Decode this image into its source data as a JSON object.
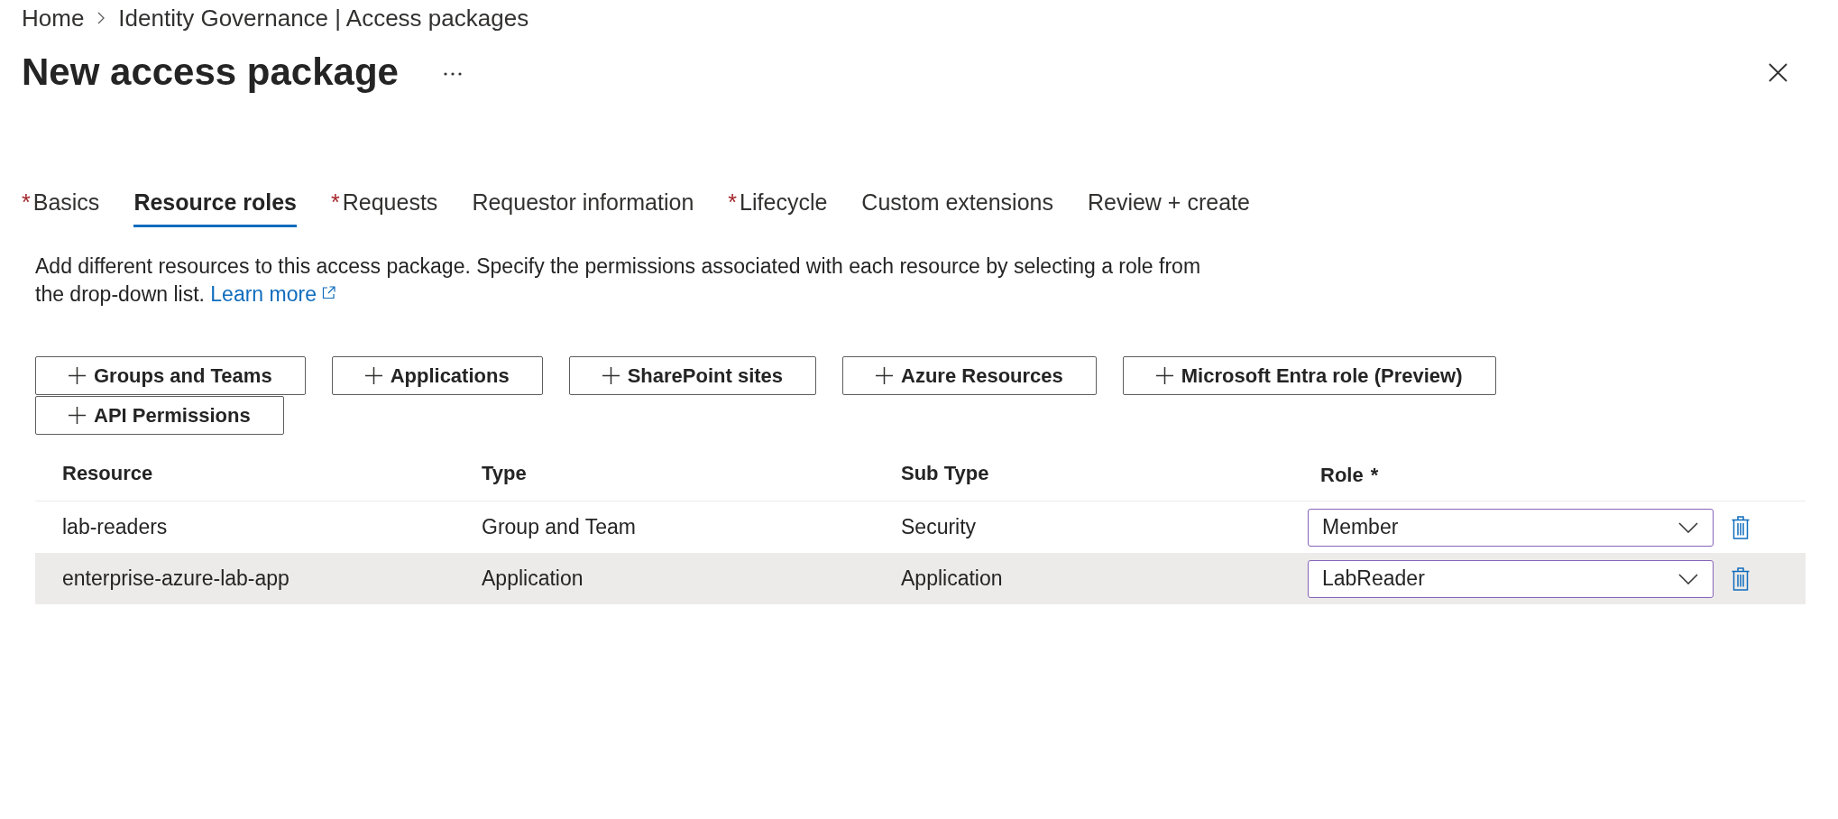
{
  "breadcrumb": [
    {
      "label": "Home"
    },
    {
      "label": "Identity Governance | Access packages"
    }
  ],
  "header": {
    "title": "New access package"
  },
  "tabs": [
    {
      "label": "Basics",
      "marker": "*",
      "selected": false
    },
    {
      "label": "Resource roles",
      "selected": true
    },
    {
      "label": "Requests",
      "marker": "*",
      "selected": false
    },
    {
      "label": "Requestor information",
      "selected": false
    },
    {
      "label": "Lifecycle",
      "marker": "*",
      "selected": false
    },
    {
      "label": "Custom extensions",
      "selected": false
    },
    {
      "label": "Review + create",
      "selected": false
    }
  ],
  "description": {
    "text": "Add different resources to this access package. Specify the permissions associated with each resource by selecting a role from the drop-down list.",
    "link": "Learn more"
  },
  "add_buttons": [
    {
      "label": "Groups and Teams"
    },
    {
      "label": "Applications"
    },
    {
      "label": "SharePoint sites"
    },
    {
      "label": "Azure Resources"
    },
    {
      "label": "Microsoft Entra role (Preview)"
    },
    {
      "label": "API Permissions"
    }
  ],
  "table": {
    "columns": [
      {
        "label": "Resource"
      },
      {
        "label": "Type"
      },
      {
        "label": "Sub Type"
      },
      {
        "label": "Role",
        "marker": "*"
      }
    ],
    "rows": [
      {
        "cells": [
          "lab-readers",
          "Group and Team",
          "Security"
        ],
        "role": "Member",
        "selected": false
      },
      {
        "cells": [
          "enterprise-azure-lab-app",
          "Application",
          "Application"
        ],
        "role": "LabReader",
        "selected": true
      }
    ]
  }
}
